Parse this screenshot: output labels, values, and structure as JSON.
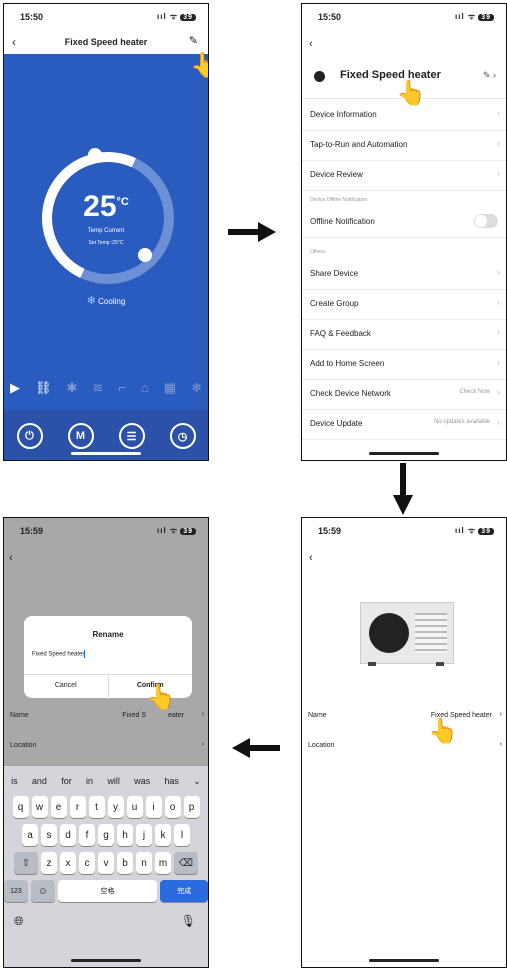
{
  "screen1": {
    "time": "15:50",
    "status_icons": "ııl ᯤ",
    "battery": "39",
    "title": "Fixed Speed heater",
    "temperature": "25",
    "unit": "°C",
    "temp_label": "Temp Current",
    "set_temp": "Set Temp :25°C",
    "mode_label": "Cooling",
    "bottom_buttons": [
      "⏻",
      "M",
      "☰",
      "◷"
    ]
  },
  "screen2": {
    "time": "15:50",
    "battery": "39",
    "device_name": "Fixed Speed heater",
    "rows": {
      "device_information": "Device Information",
      "tap_to_run": "Tap-to-Run and Automation",
      "device_review": "Device Review",
      "section_offline": "Device Offline Notification",
      "offline_notification": "Offline Notification",
      "section_others": "Others",
      "share_device": "Share Device",
      "create_group": "Create Group",
      "faq": "FAQ & Feedback",
      "add_home": "Add to Home Screen",
      "check_network": "Check Device Network",
      "check_now": "Check Now",
      "device_update": "Device Update",
      "no_updates": "No updates available"
    }
  },
  "screen3": {
    "time": "15:59",
    "battery": "39",
    "name_label": "Name",
    "name_value": "Fixed Speed heater",
    "location_label": "Location"
  },
  "screen4": {
    "time": "15:59",
    "battery": "39",
    "dialog_title": "Rename",
    "input_value": "Fixed Speed heater",
    "cancel": "Cancel",
    "confirm": "Confirm",
    "name_label": "Name",
    "name_value": "Fixed S",
    "name_value_tail": "eater",
    "location_label": "Location",
    "suggestions": [
      "is",
      "and",
      "for",
      "in",
      "will",
      "was",
      "has",
      "⌄"
    ],
    "keys_row1": [
      "q",
      "w",
      "e",
      "r",
      "t",
      "y",
      "u",
      "i",
      "o",
      "p"
    ],
    "keys_row2": [
      "a",
      "s",
      "d",
      "f",
      "g",
      "h",
      "j",
      "k",
      "l"
    ],
    "keys_row3": [
      "z",
      "x",
      "c",
      "v",
      "b",
      "n",
      "m"
    ],
    "space": "空格",
    "done": "完成",
    "num_key": "123"
  }
}
